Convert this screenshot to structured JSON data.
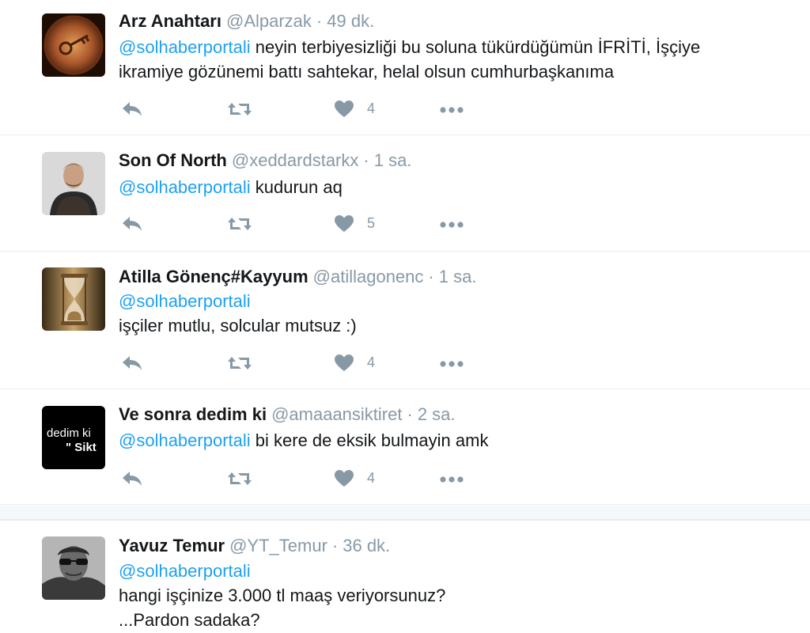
{
  "colors": {
    "mention": "#1da1f2",
    "muted": "#8899a6",
    "text": "#14171a",
    "divider": "#e6ecf0"
  },
  "tweets": [
    {
      "name": "Arz Anahtarı",
      "handle": "@Alparzak",
      "time": "49 dk.",
      "mention": "@solhaberportali",
      "line1_rest": " neyin terbiyesizliği bu soluna tükürdüğümün İFRİTİ, İşçiye",
      "line2": "ikramiye gözünemi battı sahtekar, helal olsun cumhurbaşkanıma",
      "likes": "4",
      "avatar_icon": "key-ornament-avatar"
    },
    {
      "name": "Son Of North",
      "handle": "@xeddardstarkx",
      "time": "1 sa.",
      "mention": "@solhaberportali",
      "line1_rest": " kudurun aq",
      "likes": "5",
      "avatar_icon": "man-portrait-avatar"
    },
    {
      "name": "Atilla Gönenç#Kayyum",
      "handle": "@atillagonenc",
      "time": "1 sa.",
      "mention": "@solhaberportali",
      "line2": "işçiler mutlu, solcular mutsuz :)",
      "likes": "4",
      "avatar_icon": "hourglass-avatar"
    },
    {
      "name": "Ve sonra dedim ki",
      "handle": "@amaaansiktiret",
      "time": "2 sa.",
      "mention": "@solhaberportali",
      "line1_rest": " bi kere de eksik bulmayin amk",
      "likes": "4",
      "avatar_text1": "dedim ki",
      "avatar_text2": "\" Sikt"
    },
    {
      "name": "Yavuz Temur",
      "handle": "@YT_Temur",
      "time": "36 dk.",
      "mention": "@solhaberportali",
      "line2": "hangi işçinize 3.000 tl maaş veriyorsunuz?",
      "line3": "...Pardon sadaka?",
      "avatar_icon": "man-sunglasses-avatar"
    }
  ]
}
